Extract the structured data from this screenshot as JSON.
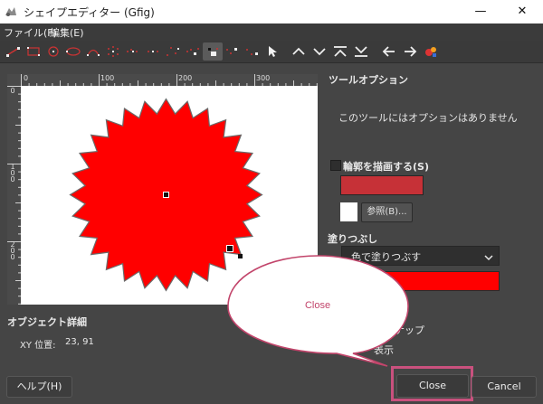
{
  "window": {
    "title": "シェイプエディター (Gfig)",
    "minimize": "—",
    "close": "✕"
  },
  "menu": {
    "file": "ファイル(F)",
    "edit": "編集(E)"
  },
  "toolbar": {
    "icons": [
      "line-tool",
      "rectangle-tool",
      "circle-tool",
      "ellipse-tool",
      "arc-tool",
      "polygon-tool",
      "star-tool",
      "spiral-tool",
      "bezier-tool",
      "move-object-tool",
      "move-point-tool",
      "copy-object-tool",
      "delete-object-tool",
      "select-object-tool",
      "raise-object",
      "lower-object",
      "raise-to-top",
      "lower-to-bottom",
      "prev-object",
      "next-object",
      "show-all-objects"
    ],
    "active": "move-point-tool"
  },
  "ruler": {
    "top": [
      "0",
      "100",
      "200",
      "300"
    ],
    "left": [
      [
        "0"
      ],
      [
        "1",
        "0",
        "0"
      ],
      [
        "2",
        "0",
        "0"
      ]
    ]
  },
  "canvas": {
    "shape": "star",
    "fill_color": "#ff0000",
    "outline_color": "#6a6a6a",
    "star_points": 28
  },
  "details": {
    "heading": "オブジェクト詳細",
    "xy_label": "XY 位置:",
    "xy_value": "23, 91"
  },
  "tool_options": {
    "heading": "ツールオプション",
    "message": "このツールにはオプションはありません"
  },
  "stroke": {
    "label": "輪郭を描画する(S)",
    "checked": false,
    "color": "#c63137",
    "browse_label": "参照(B)..."
  },
  "fill": {
    "label": "塗りつぶし",
    "selected": "色で塗りつぶす",
    "color": "#ff0000"
  },
  "grid": {
    "show_partial": "示",
    "snap_partial": "スナップ",
    "display_partial": "表示"
  },
  "callout": {
    "text": "Close",
    "color": "#c2456b"
  },
  "buttons": {
    "help": "ヘルプ(H)",
    "close": "Close",
    "cancel": "Cancel"
  }
}
